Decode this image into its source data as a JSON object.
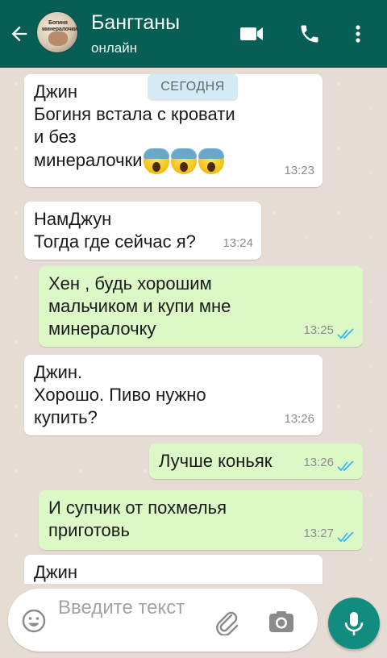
{
  "header": {
    "title": "Бангтаны",
    "status": "онлайн",
    "avatar_caption": "Богиня минералочки"
  },
  "date_divider": "СЕГОДНЯ",
  "messages": [
    {
      "direction": "in",
      "sender": "Джин",
      "text": "Богиня встала с кровати\nи без\nминералочки",
      "emoji": "screaming-face x3",
      "time": "13:23"
    },
    {
      "direction": "in",
      "sender": "НамДжун",
      "text": "Тогда где сейчас я?",
      "time": "13:24"
    },
    {
      "direction": "out",
      "text": "Хен , будь хорошим\nмальчиком и купи мне\nминералочку",
      "time": "13:25",
      "status": "read"
    },
    {
      "direction": "in",
      "sender": "Джин.",
      "text": "Хорошо. Пиво нужно\nкупить?",
      "time": "13:26"
    },
    {
      "direction": "out",
      "text": "Лучше коньяк",
      "time": "13:26",
      "status": "read"
    },
    {
      "direction": "out",
      "text": "И супчик от похмелья\nприготовь",
      "time": "13:27",
      "status": "read"
    },
    {
      "direction": "in",
      "sender": "Джин",
      "text": "",
      "time": ""
    }
  ],
  "composer": {
    "placeholder": "Введите текст"
  },
  "colors": {
    "header": "#075e54",
    "incoming_bubble": "#ffffff",
    "outgoing_bubble": "#dcf8c6",
    "read_ticks": "#34b7f1",
    "mic_button": "#128c7e"
  },
  "icons": [
    "back-arrow-icon",
    "video-call-icon",
    "phone-icon",
    "more-vert-icon",
    "emoji-icon",
    "attach-icon",
    "camera-icon",
    "mic-icon",
    "double-check-icon"
  ]
}
